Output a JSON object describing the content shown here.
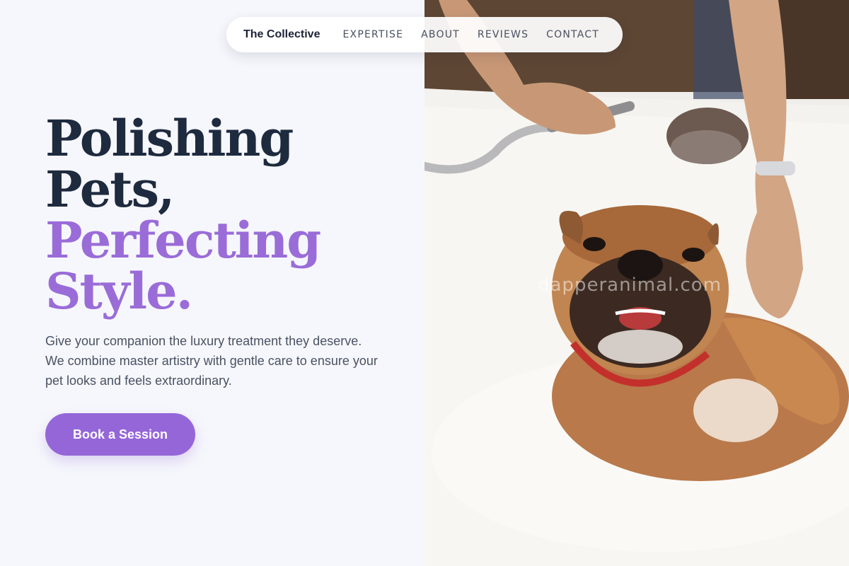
{
  "nav": {
    "brand": "The Collective",
    "links": [
      "EXPERTISE",
      "ABOUT",
      "REVIEWS",
      "CONTACT"
    ]
  },
  "hero": {
    "headline_line1": "Polishing",
    "headline_line2": "Pets,",
    "headline_line3": "Perfecting",
    "headline_line4": "Style.",
    "description": "Give your companion the luxury treatment they deserve. We combine master artistry with gentle care to ensure your pet looks and feels extraordinary.",
    "cta_label": "Book a Session"
  },
  "photo": {
    "watermark": "dapperanimal.com"
  },
  "colors": {
    "background": "#f6f7fc",
    "heading_dark": "#1e2a3e",
    "accent_purple": "#9a6cd8",
    "button": "#9566d8"
  }
}
